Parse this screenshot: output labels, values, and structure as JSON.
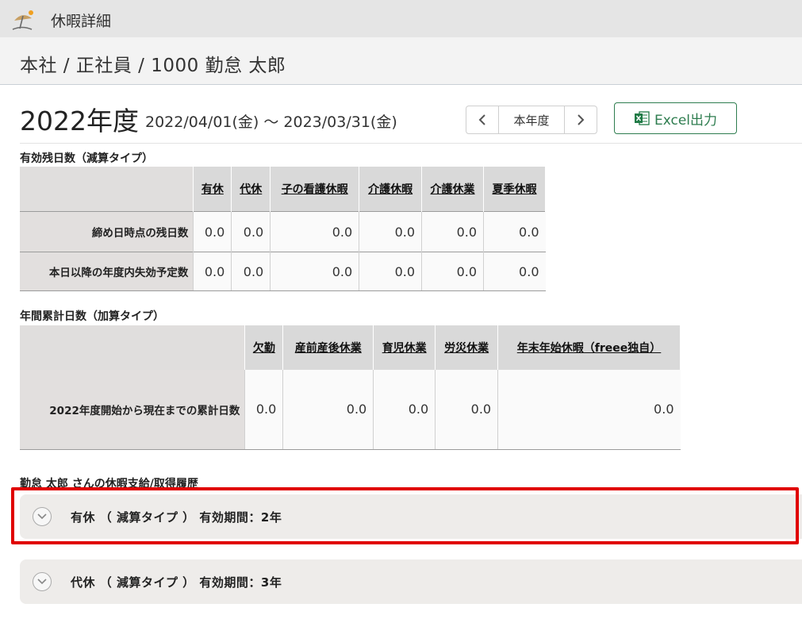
{
  "window": {
    "title": "休暇詳細",
    "icon": "beach-umbrella-icon"
  },
  "breadcrumb": "本社 / 正社員 / 1000 勤怠 太郎",
  "year": {
    "title": "2022年度",
    "range": "2022/04/01(金) ～ 2023/03/31(金)",
    "nav_current": "本年度",
    "excel_label": "Excel出力"
  },
  "remaining": {
    "section_label": "有効残日数（減算タイプ）",
    "columns": [
      "有休",
      "代休",
      "子の看護休暇",
      "介護休暇",
      "介護休業",
      "夏季休暇"
    ],
    "rows": [
      {
        "label": "締め日時点の残日数",
        "values": [
          "0.0",
          "0.0",
          "0.0",
          "0.0",
          "0.0",
          "0.0"
        ]
      },
      {
        "label": "本日以降の年度内失効予定数",
        "values": [
          "0.0",
          "0.0",
          "0.0",
          "0.0",
          "0.0",
          "0.0"
        ]
      }
    ]
  },
  "cumulative": {
    "section_label": "年間累計日数（加算タイプ）",
    "columns": [
      "欠勤",
      "産前産後休業",
      "育児休業",
      "労災休業",
      "年末年始休暇（freee独自）"
    ],
    "rows": [
      {
        "label": "2022年度開始から現在までの累計日数",
        "values": [
          "0.0",
          "0.0",
          "0.0",
          "0.0",
          "0.0"
        ]
      }
    ]
  },
  "history": {
    "section_label": "勤怠 太郎 さんの休暇支給/取得履歴",
    "items": [
      {
        "label": "有休 （ 減算タイプ ） 有効期間：2年"
      },
      {
        "label": "代休 （ 減算タイプ ） 有効期間：3年"
      }
    ]
  },
  "colors": {
    "highlight": "#e00000",
    "excel": "#2e7d4f"
  }
}
